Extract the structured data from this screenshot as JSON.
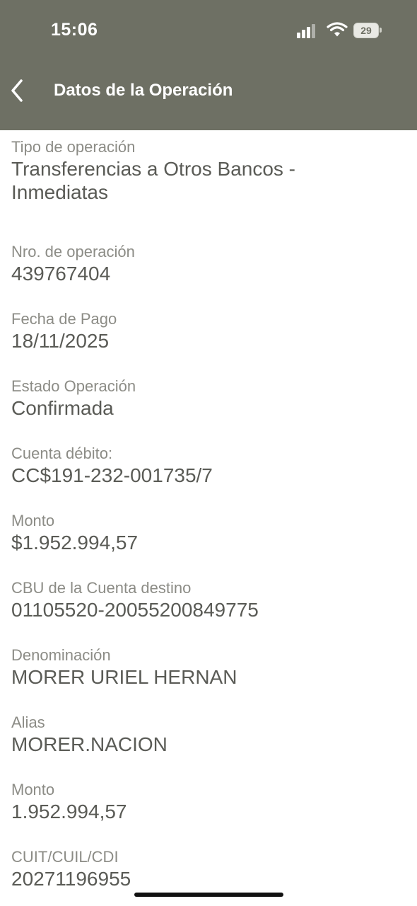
{
  "status_bar": {
    "time": "15:06",
    "battery": "29"
  },
  "header": {
    "title": "Datos de la Operación"
  },
  "fields": [
    {
      "label": "Tipo de operación",
      "value": "Transferencias a Otros Bancos - Inmediatas"
    },
    {
      "label": "Nro. de operación",
      "value": "439767404"
    },
    {
      "label": "Fecha de Pago",
      "value": "18/11/2025"
    },
    {
      "label": "Estado Operación",
      "value": "Confirmada"
    },
    {
      "label": "Cuenta débito:",
      "value": "CC$191-232-001735/7"
    },
    {
      "label": "Monto",
      "value": "$1.952.994,57"
    },
    {
      "label": "CBU de la Cuenta destino",
      "value": "01105520-20055200849775"
    },
    {
      "label": "Denominación",
      "value": "MORER URIEL HERNAN"
    },
    {
      "label": "Alias",
      "value": "MORER.NACION"
    },
    {
      "label": "Monto",
      "value": "1.952.994,57"
    },
    {
      "label": "CUIT/CUIL/CDI",
      "value": "20271196955"
    }
  ],
  "icons": [
    "back-arrow-icon",
    "signal-icon",
    "wifi-icon",
    "battery-icon"
  ],
  "colors": {
    "header_bg": "#6e7064",
    "label": "#8c8c86",
    "value": "#5a5b56"
  }
}
